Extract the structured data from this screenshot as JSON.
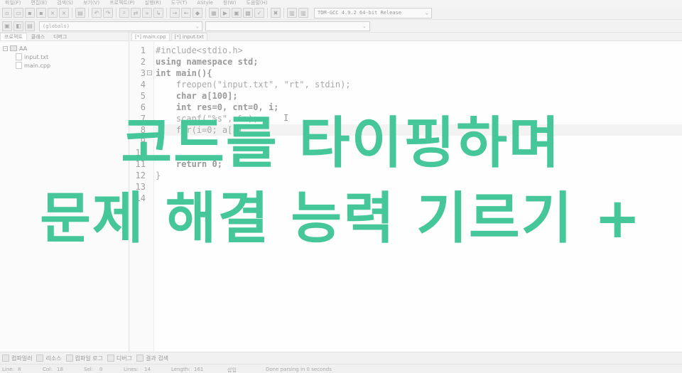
{
  "menu": [
    "파일(F)",
    "편집(E)",
    "검색(S)",
    "보기(V)",
    "프로젝트(P)",
    "실행(R)",
    "도구(T)",
    "AStyle",
    "창(W)",
    "도움말(H)"
  ],
  "compiler": {
    "selected": "TDM-GCC 4.9.2 64-bit Release"
  },
  "scope": {
    "selected": "(globals)"
  },
  "left_tabs": [
    "프로젝트",
    "클래스",
    "디버그"
  ],
  "project": {
    "name": "AA",
    "files": [
      "input.txt",
      "main.cpp"
    ]
  },
  "editor_tabs": [
    "[*] main.cpp",
    "[*] input.txt"
  ],
  "code": {
    "line_numbers": [
      "1",
      "2",
      "3",
      "4",
      "5",
      "6",
      "7",
      "8",
      "9",
      "10",
      "11",
      "12",
      "13",
      "14"
    ],
    "lines": [
      "#include<stdio.h>",
      "using namespace std;",
      "int main(){",
      "    freopen(\"input.txt\", \"rt\", stdin);",
      "    char a[100];",
      "    int res=0, cnt=0, i;",
      "    scanf(\"%s\", &a);",
      "    for(i=0; a[i]",
      "",
      "",
      "    return 0;",
      "}",
      "",
      ""
    ],
    "cursor_glyph": "I"
  },
  "overlay": {
    "line1": "코드를 타이핑하며",
    "line2": "문제 해결 능력 기르기 +"
  },
  "bottom_tabs": [
    "컴파일러",
    "리소스",
    "컴파일 로그",
    "디버그",
    "결과 검색"
  ],
  "status": {
    "line": "Line:",
    "line_val": "8",
    "col": "Col:",
    "col_val": "18",
    "sel": "Sel:",
    "sel_val": "0",
    "lines": "Lines:",
    "lines_val": "14",
    "length": "Length:",
    "length_val": "161",
    "mode": "삽입",
    "message": "Done parsing in 0 seconds"
  },
  "colors": {
    "overlay_text": "#45c79a"
  }
}
